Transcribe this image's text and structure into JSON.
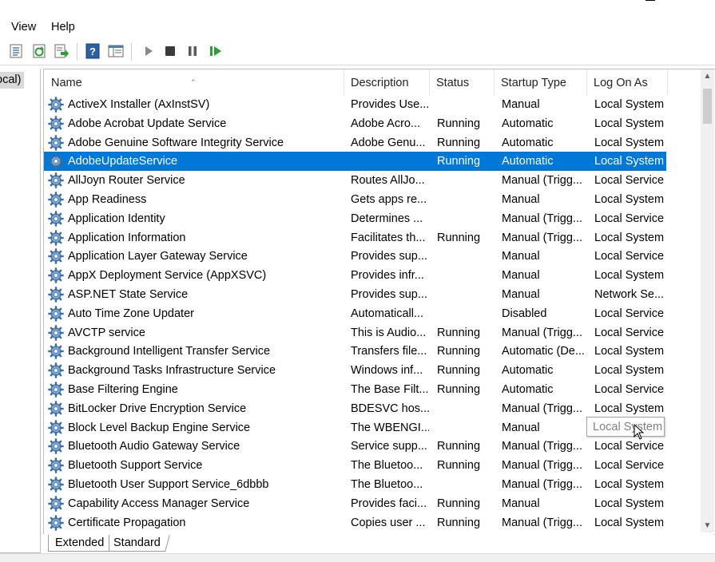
{
  "menu": {
    "items": [
      "View",
      "Help"
    ]
  },
  "toolbar": {
    "buttons": [
      "properties-icon",
      "refresh-icon",
      "export-list-icon",
      "help-icon",
      "show-hide-console-tree-icon",
      "start-service-icon",
      "stop-service-icon",
      "pause-service-icon",
      "resume-service-icon"
    ]
  },
  "tree": {
    "selected_label": "ocal)"
  },
  "columns": {
    "name": "Name",
    "description": "Description",
    "status": "Status",
    "startup_type": "Startup Type",
    "log_on_as": "Log On As"
  },
  "services": [
    {
      "name": "ActiveX Installer (AxInstSV)",
      "description": "Provides Use...",
      "status": "",
      "startup_type": "Manual",
      "log_on_as": "Local System"
    },
    {
      "name": "Adobe Acrobat Update Service",
      "description": "Adobe Acro...",
      "status": "Running",
      "startup_type": "Automatic",
      "log_on_as": "Local System"
    },
    {
      "name": "Adobe Genuine Software Integrity Service",
      "description": "Adobe Genu...",
      "status": "Running",
      "startup_type": "Automatic",
      "log_on_as": "Local System"
    },
    {
      "name": "AdobeUpdateService",
      "description": "",
      "status": "Running",
      "startup_type": "Automatic",
      "log_on_as": "Local System",
      "selected": true
    },
    {
      "name": "AllJoyn Router Service",
      "description": "Routes AllJo...",
      "status": "",
      "startup_type": "Manual (Trigg...",
      "log_on_as": "Local Service"
    },
    {
      "name": "App Readiness",
      "description": "Gets apps re...",
      "status": "",
      "startup_type": "Manual",
      "log_on_as": "Local System"
    },
    {
      "name": "Application Identity",
      "description": "Determines ...",
      "status": "",
      "startup_type": "Manual (Trigg...",
      "log_on_as": "Local Service"
    },
    {
      "name": "Application Information",
      "description": "Facilitates th...",
      "status": "Running",
      "startup_type": "Manual (Trigg...",
      "log_on_as": "Local System"
    },
    {
      "name": "Application Layer Gateway Service",
      "description": "Provides sup...",
      "status": "",
      "startup_type": "Manual",
      "log_on_as": "Local Service"
    },
    {
      "name": "AppX Deployment Service (AppXSVC)",
      "description": "Provides infr...",
      "status": "",
      "startup_type": "Manual",
      "log_on_as": "Local System"
    },
    {
      "name": "ASP.NET State Service",
      "description": "Provides sup...",
      "status": "",
      "startup_type": "Manual",
      "log_on_as": "Network Se..."
    },
    {
      "name": "Auto Time Zone Updater",
      "description": "Automaticall...",
      "status": "",
      "startup_type": "Disabled",
      "log_on_as": "Local Service"
    },
    {
      "name": "AVCTP service",
      "description": "This is Audio...",
      "status": "Running",
      "startup_type": "Manual (Trigg...",
      "log_on_as": "Local Service"
    },
    {
      "name": "Background Intelligent Transfer Service",
      "description": "Transfers file...",
      "status": "Running",
      "startup_type": "Automatic (De...",
      "log_on_as": "Local System"
    },
    {
      "name": "Background Tasks Infrastructure Service",
      "description": "Windows inf...",
      "status": "Running",
      "startup_type": "Automatic",
      "log_on_as": "Local System"
    },
    {
      "name": "Base Filtering Engine",
      "description": "The Base Filt...",
      "status": "Running",
      "startup_type": "Automatic",
      "log_on_as": "Local Service"
    },
    {
      "name": "BitLocker Drive Encryption Service",
      "description": "BDESVC hos...",
      "status": "",
      "startup_type": "Manual (Trigg...",
      "log_on_as": "Local System"
    },
    {
      "name": "Block Level Backup Engine Service",
      "description": "The WBENGI...",
      "status": "",
      "startup_type": "Manual",
      "log_on_as": ""
    },
    {
      "name": "Bluetooth Audio Gateway Service",
      "description": "Service supp...",
      "status": "Running",
      "startup_type": "Manual (Trigg...",
      "log_on_as": "Local Service"
    },
    {
      "name": "Bluetooth Support Service",
      "description": "The Bluetoo...",
      "status": "Running",
      "startup_type": "Manual (Trigg...",
      "log_on_as": "Local Service"
    },
    {
      "name": "Bluetooth User Support Service_6dbbb",
      "description": "The Bluetoo...",
      "status": "",
      "startup_type": "Manual (Trigg...",
      "log_on_as": "Local System"
    },
    {
      "name": "Capability Access Manager Service",
      "description": "Provides faci...",
      "status": "Running",
      "startup_type": "Manual",
      "log_on_as": "Local System"
    },
    {
      "name": "Certificate Propagation",
      "description": "Copies user ...",
      "status": "Running",
      "startup_type": "Manual (Trigg...",
      "log_on_as": "Local System"
    }
  ],
  "tooltip": {
    "text": "Local System"
  },
  "tabs": {
    "extended": "Extended",
    "standard": "Standard"
  },
  "colors": {
    "selection": "#0078d7",
    "gear": "#4a7fb5"
  }
}
